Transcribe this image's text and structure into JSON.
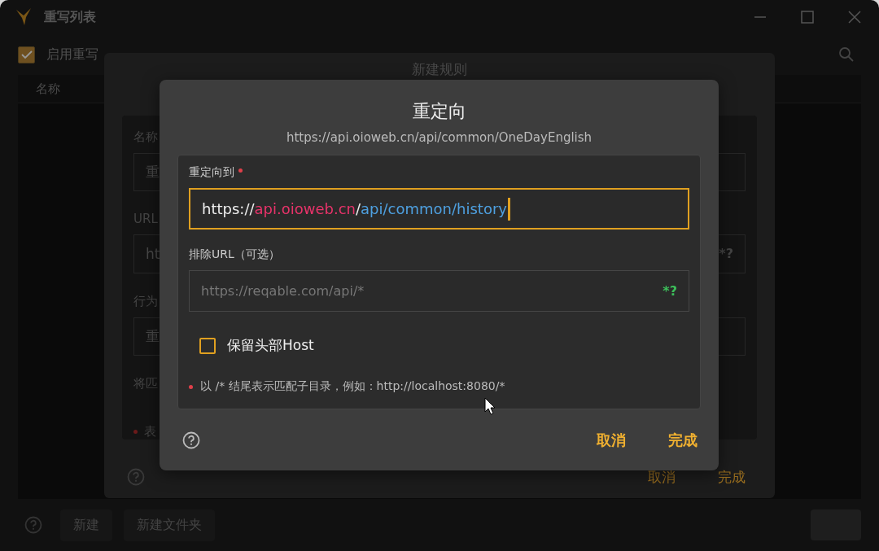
{
  "window": {
    "title": "重写列表"
  },
  "toolbar": {
    "enable_rewrite": {
      "label": "启用重写",
      "checked": true
    }
  },
  "table": {
    "columns": [
      "名称"
    ]
  },
  "bottom_bar": {
    "buttons": [
      "新建",
      "新建文件夹"
    ]
  },
  "rule_dialog": {
    "title": "新建规则",
    "fields": [
      {
        "label": "名称",
        "value": "重"
      },
      {
        "label": "URL",
        "value": "ht",
        "suffix": "*?"
      },
      {
        "label": "行为",
        "value": "重"
      }
    ],
    "hint": "将匹",
    "note": "表",
    "buttons": [
      "取消",
      "完成"
    ]
  },
  "redirect_dialog": {
    "title": "重定向",
    "subtitle": "https://api.oioweb.cn/api/common/OneDayEnglish",
    "target": {
      "label": "重定向到",
      "required": true,
      "segments": [
        {
          "text": "https://",
          "color": "#eeeeee"
        },
        {
          "text": "api.oioweb.cn",
          "color": "#e8336a"
        },
        {
          "text": "/",
          "color": "#eeeeee"
        },
        {
          "text": "api/common/history",
          "color": "#4ea0e0"
        }
      ]
    },
    "exclude": {
      "label": "排除URL（可选）",
      "placeholder": "https://reqable.com/api/*",
      "suffix": "*?"
    },
    "keep_host": {
      "label": "保留头部Host",
      "checked": false
    },
    "note": "以 /* 结尾表示匹配子目录，例如：http://localhost:8080/*",
    "buttons": [
      "取消",
      "完成"
    ]
  }
}
